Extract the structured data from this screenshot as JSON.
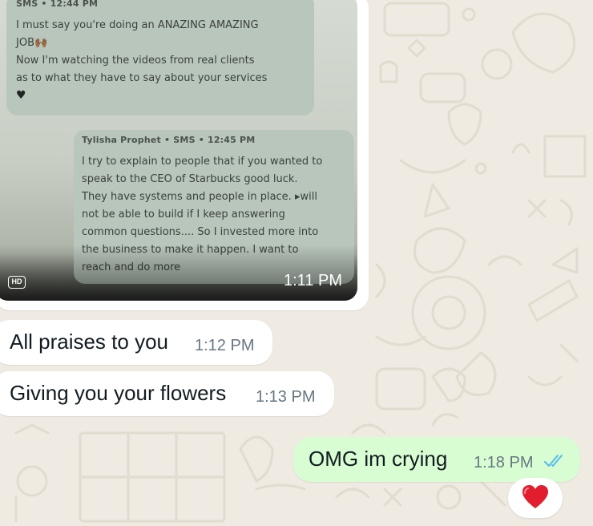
{
  "photo_message": {
    "sms_1": {
      "meta": "SMS • 12:44 PM",
      "body": "I must say you're doing an ANAZING AMAZING\nJOB🙌🏾\nNow I'm watching the videos from real clients\nas to what they have to say about your services",
      "heart": "♥"
    },
    "sms_2": {
      "meta": "Tylisha Prophet • SMS • 12:45 PM",
      "body": "I try to explain to people that if you wanted to\nspeak to the CEO of Starbucks good luck.\nThey have systems and people in place. ▸will\nnot be able to build if I keep answering\ncommon questions.... So I invested more into\nthe business to make it happen. I want to\nreach and do more"
    },
    "hd_badge": "HD",
    "time": "1:11 PM"
  },
  "messages": [
    {
      "text": "All praises to you",
      "time": "1:12 PM",
      "direction": "incoming"
    },
    {
      "text": "Giving you your flowers",
      "time": "1:13 PM",
      "direction": "incoming"
    },
    {
      "text": "OMG im crying",
      "time": "1:18 PM",
      "direction": "outgoing",
      "status": "read"
    }
  ],
  "reaction": {
    "emoji": "heart",
    "color": "#e11d2e"
  },
  "colors": {
    "wallpaper": "#efeae2",
    "incoming_bubble": "#ffffff",
    "outgoing_bubble": "#d9fdd3",
    "read_ticks": "#53bdeb",
    "timestamp": "#667781"
  }
}
